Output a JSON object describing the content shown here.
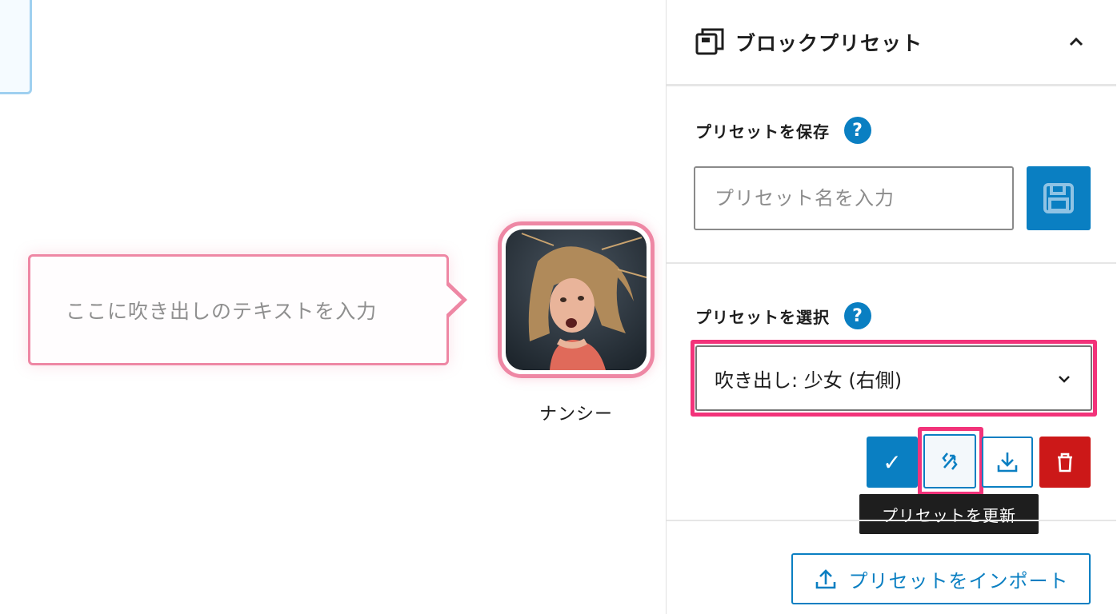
{
  "canvas": {
    "bubble_text": "ここに吹き出しのテキストを入力",
    "avatar_name": "ナンシー"
  },
  "sidebar": {
    "panel_title": "ブロックプリセット",
    "save_section": {
      "label": "プリセットを保存",
      "help": "?",
      "input_placeholder": "プリセット名を入力"
    },
    "select_section": {
      "label": "プリセットを選択",
      "help": "?",
      "selected_value": "吹き出し: 少女 (右側)"
    },
    "actions": {
      "apply_glyph": "✓",
      "tooltip": "プリセットを更新"
    },
    "import_label": "プリセットをインポート"
  },
  "colors": {
    "accent": "#0a7fc2",
    "highlight": "#f2337a",
    "bubble_border": "#ee87a4",
    "danger": "#cc1818"
  },
  "icons": [
    "block-preset-icon",
    "chevron-up-icon",
    "help-icon",
    "save-icon",
    "chevron-down-icon",
    "check-icon",
    "update-icon",
    "download-icon",
    "trash-icon",
    "upload-icon"
  ]
}
